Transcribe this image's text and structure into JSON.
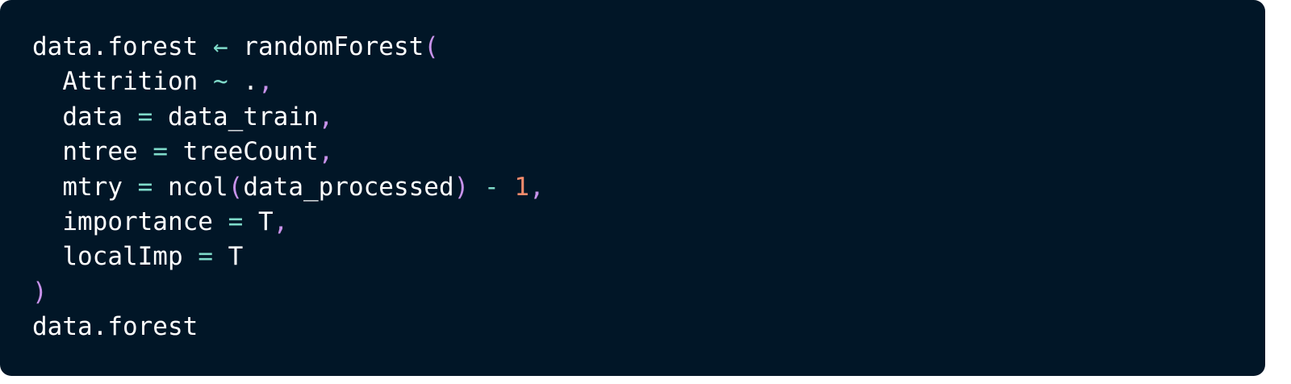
{
  "colors": {
    "background": "#011627",
    "text": "#ffffff",
    "operator": "#7fdbca",
    "punctuation": "#c792ea",
    "number": "#f78c6c"
  },
  "code": {
    "language": "R",
    "lines": [
      [
        {
          "text": "data.forest ",
          "kind": "text"
        },
        {
          "text": "←",
          "kind": "operator"
        },
        {
          "text": " randomForest",
          "kind": "text"
        },
        {
          "text": "(",
          "kind": "punctuation"
        }
      ],
      [
        {
          "text": "  Attrition ",
          "kind": "text"
        },
        {
          "text": "~",
          "kind": "operator"
        },
        {
          "text": " .",
          "kind": "text"
        },
        {
          "text": ",",
          "kind": "punctuation"
        }
      ],
      [
        {
          "text": "  data ",
          "kind": "text"
        },
        {
          "text": "=",
          "kind": "operator"
        },
        {
          "text": " data_train",
          "kind": "text"
        },
        {
          "text": ",",
          "kind": "punctuation"
        }
      ],
      [
        {
          "text": "  ntree ",
          "kind": "text"
        },
        {
          "text": "=",
          "kind": "operator"
        },
        {
          "text": " treeCount",
          "kind": "text"
        },
        {
          "text": ",",
          "kind": "punctuation"
        }
      ],
      [
        {
          "text": "  mtry ",
          "kind": "text"
        },
        {
          "text": "=",
          "kind": "operator"
        },
        {
          "text": " ncol",
          "kind": "text"
        },
        {
          "text": "(",
          "kind": "punctuation"
        },
        {
          "text": "data_processed",
          "kind": "text"
        },
        {
          "text": ")",
          "kind": "punctuation"
        },
        {
          "text": " ",
          "kind": "text"
        },
        {
          "text": "-",
          "kind": "operator"
        },
        {
          "text": " ",
          "kind": "text"
        },
        {
          "text": "1",
          "kind": "number"
        },
        {
          "text": ",",
          "kind": "punctuation"
        }
      ],
      [
        {
          "text": "  importance ",
          "kind": "text"
        },
        {
          "text": "=",
          "kind": "operator"
        },
        {
          "text": " T",
          "kind": "text"
        },
        {
          "text": ",",
          "kind": "punctuation"
        }
      ],
      [
        {
          "text": "  localImp ",
          "kind": "text"
        },
        {
          "text": "=",
          "kind": "operator"
        },
        {
          "text": " T",
          "kind": "text"
        }
      ],
      [
        {
          "text": ")",
          "kind": "punctuation"
        }
      ],
      [
        {
          "text": "data.forest",
          "kind": "text"
        }
      ]
    ]
  }
}
